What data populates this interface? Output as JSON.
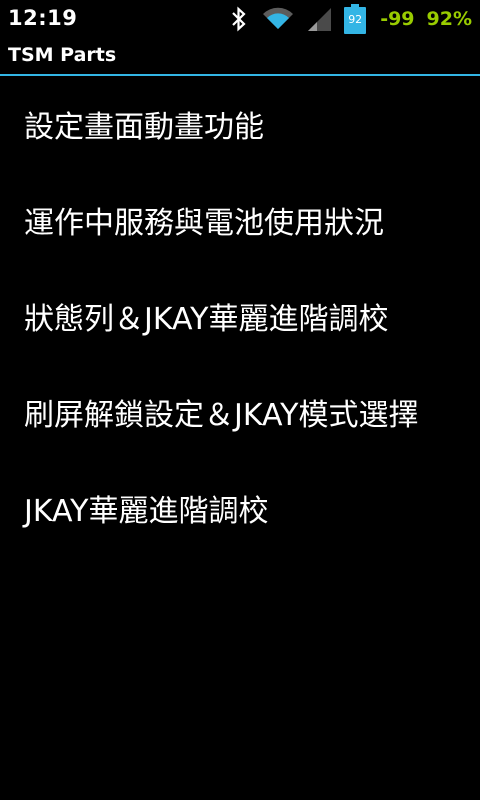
{
  "status_bar": {
    "time": "12:19",
    "battery_level": "92",
    "temperature": "-99",
    "battery_percent": "92%",
    "accent_color": "#33b5e5",
    "text_color": "#99cc00",
    "icons": [
      "bluetooth-icon",
      "wifi-icon",
      "signal-icon",
      "battery-icon"
    ]
  },
  "title_bar": {
    "title": "TSM Parts"
  },
  "menu": {
    "items": [
      {
        "label": "設定畫面動畫功能"
      },
      {
        "label": "運作中服務與電池使用狀況"
      },
      {
        "label": "狀態列＆JKAY華麗進階調校"
      },
      {
        "label": "刷屏解鎖設定＆JKAY模式選擇"
      },
      {
        "label": "JKAY華麗進階調校"
      }
    ]
  }
}
